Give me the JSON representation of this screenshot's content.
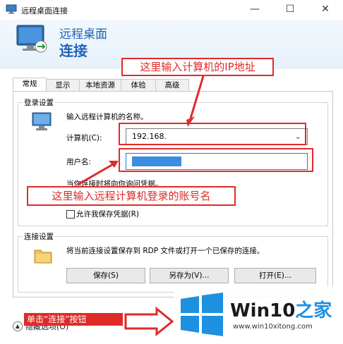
{
  "window": {
    "title": "远程桌面连接",
    "minimize": "—",
    "maximize": "☐",
    "close": "✕"
  },
  "header": {
    "line1": "远程桌面",
    "line2": "连接"
  },
  "tabs": [
    {
      "label": "常规"
    },
    {
      "label": "显示"
    },
    {
      "label": "本地资源"
    },
    {
      "label": "体验"
    },
    {
      "label": "高级"
    }
  ],
  "login": {
    "group_label": "登录设置",
    "prompt": "输入远程计算机的名称。",
    "computer_label": "计算机(C):",
    "computer_value": "192.168.",
    "username_label": "用户名:",
    "username_value": "",
    "note": "当你连接时将向你询问凭据。",
    "save_credentials_label": "允许我保存凭据(R)"
  },
  "connection": {
    "group_label": "连接设置",
    "desc": "将当前连接设置保存到 RDP 文件或打开一个已保存的连接。",
    "save_btn": "保存(S)",
    "saveas_btn": "另存为(V)...",
    "open_btn": "打开(E)..."
  },
  "footer": {
    "hide_options": "隐藏选项(O)",
    "connect_annotation": "单击“连接”按钮"
  },
  "annotations": {
    "ip_hint": "这里输入计算机的IP地址",
    "user_hint": "这里输入远程计算机登录的账号名"
  },
  "watermark": {
    "brand": "Win10",
    "brand_suffix": "之家",
    "url": "www.win10xitong.com"
  },
  "colors": {
    "accent_blue": "#1f63b8",
    "annotation_red": "#e02a2a",
    "win_blue": "#1e90e0"
  }
}
